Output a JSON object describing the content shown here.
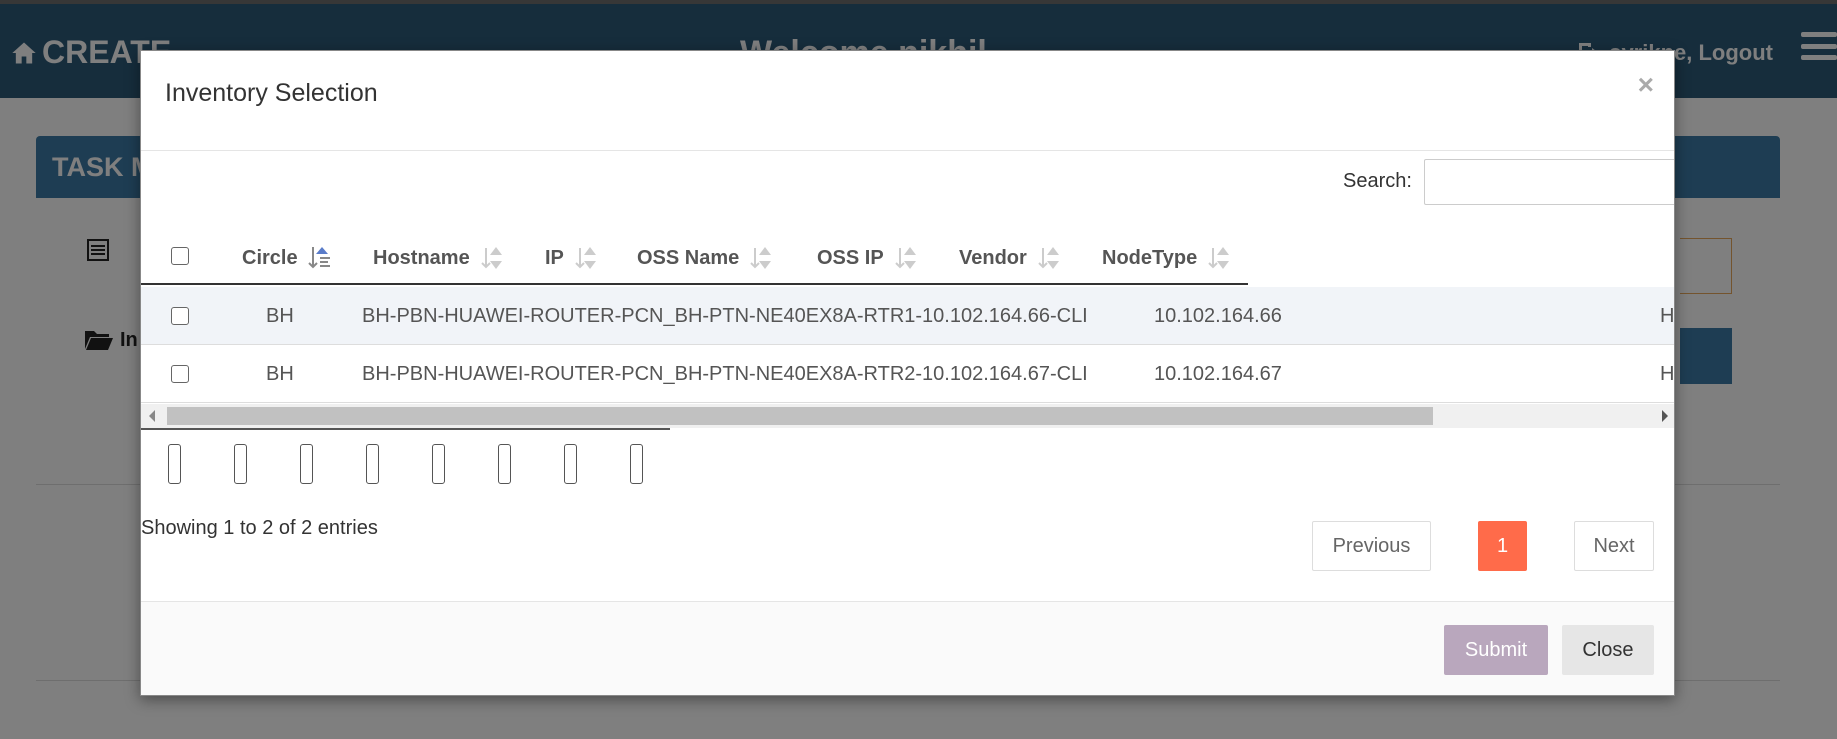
{
  "app": {
    "brand": "CREATE",
    "welcome": "Welcome nikhil",
    "user_label": "syrikne, Logout",
    "task_title": "TASK M",
    "folder_label": "In"
  },
  "modal": {
    "title": "Inventory Selection",
    "close_glyph": "×",
    "search_label": "Search:",
    "search_value": "",
    "columns": [
      "Circle",
      "Hostname",
      "IP",
      "OSS Name",
      "OSS IP",
      "Vendor",
      "NodeType"
    ],
    "rows": [
      {
        "circle": "BH",
        "hostname": "BH-PBN-HUAWEI-ROUTER-PCN_BH-PTN-NE40EX8A-RTR1-10.102.164.66-CLI",
        "ip": "10.102.164.66",
        "trailing": "H"
      },
      {
        "circle": "BH",
        "hostname": "BH-PBN-HUAWEI-ROUTER-PCN_BH-PTN-NE40EX8A-RTR2-10.102.164.67-CLI",
        "ip": "10.102.164.67",
        "trailing": "H"
      }
    ],
    "info": "Showing 1 to 2 of 2 entries",
    "pagination": {
      "previous": "Previous",
      "current": "1",
      "next": "Next"
    },
    "submit_label": "Submit",
    "close_label": "Close"
  },
  "colors": {
    "header": "#2c5a79",
    "accent_page": "#ff6b4a",
    "submit": "#b9a7bd"
  }
}
